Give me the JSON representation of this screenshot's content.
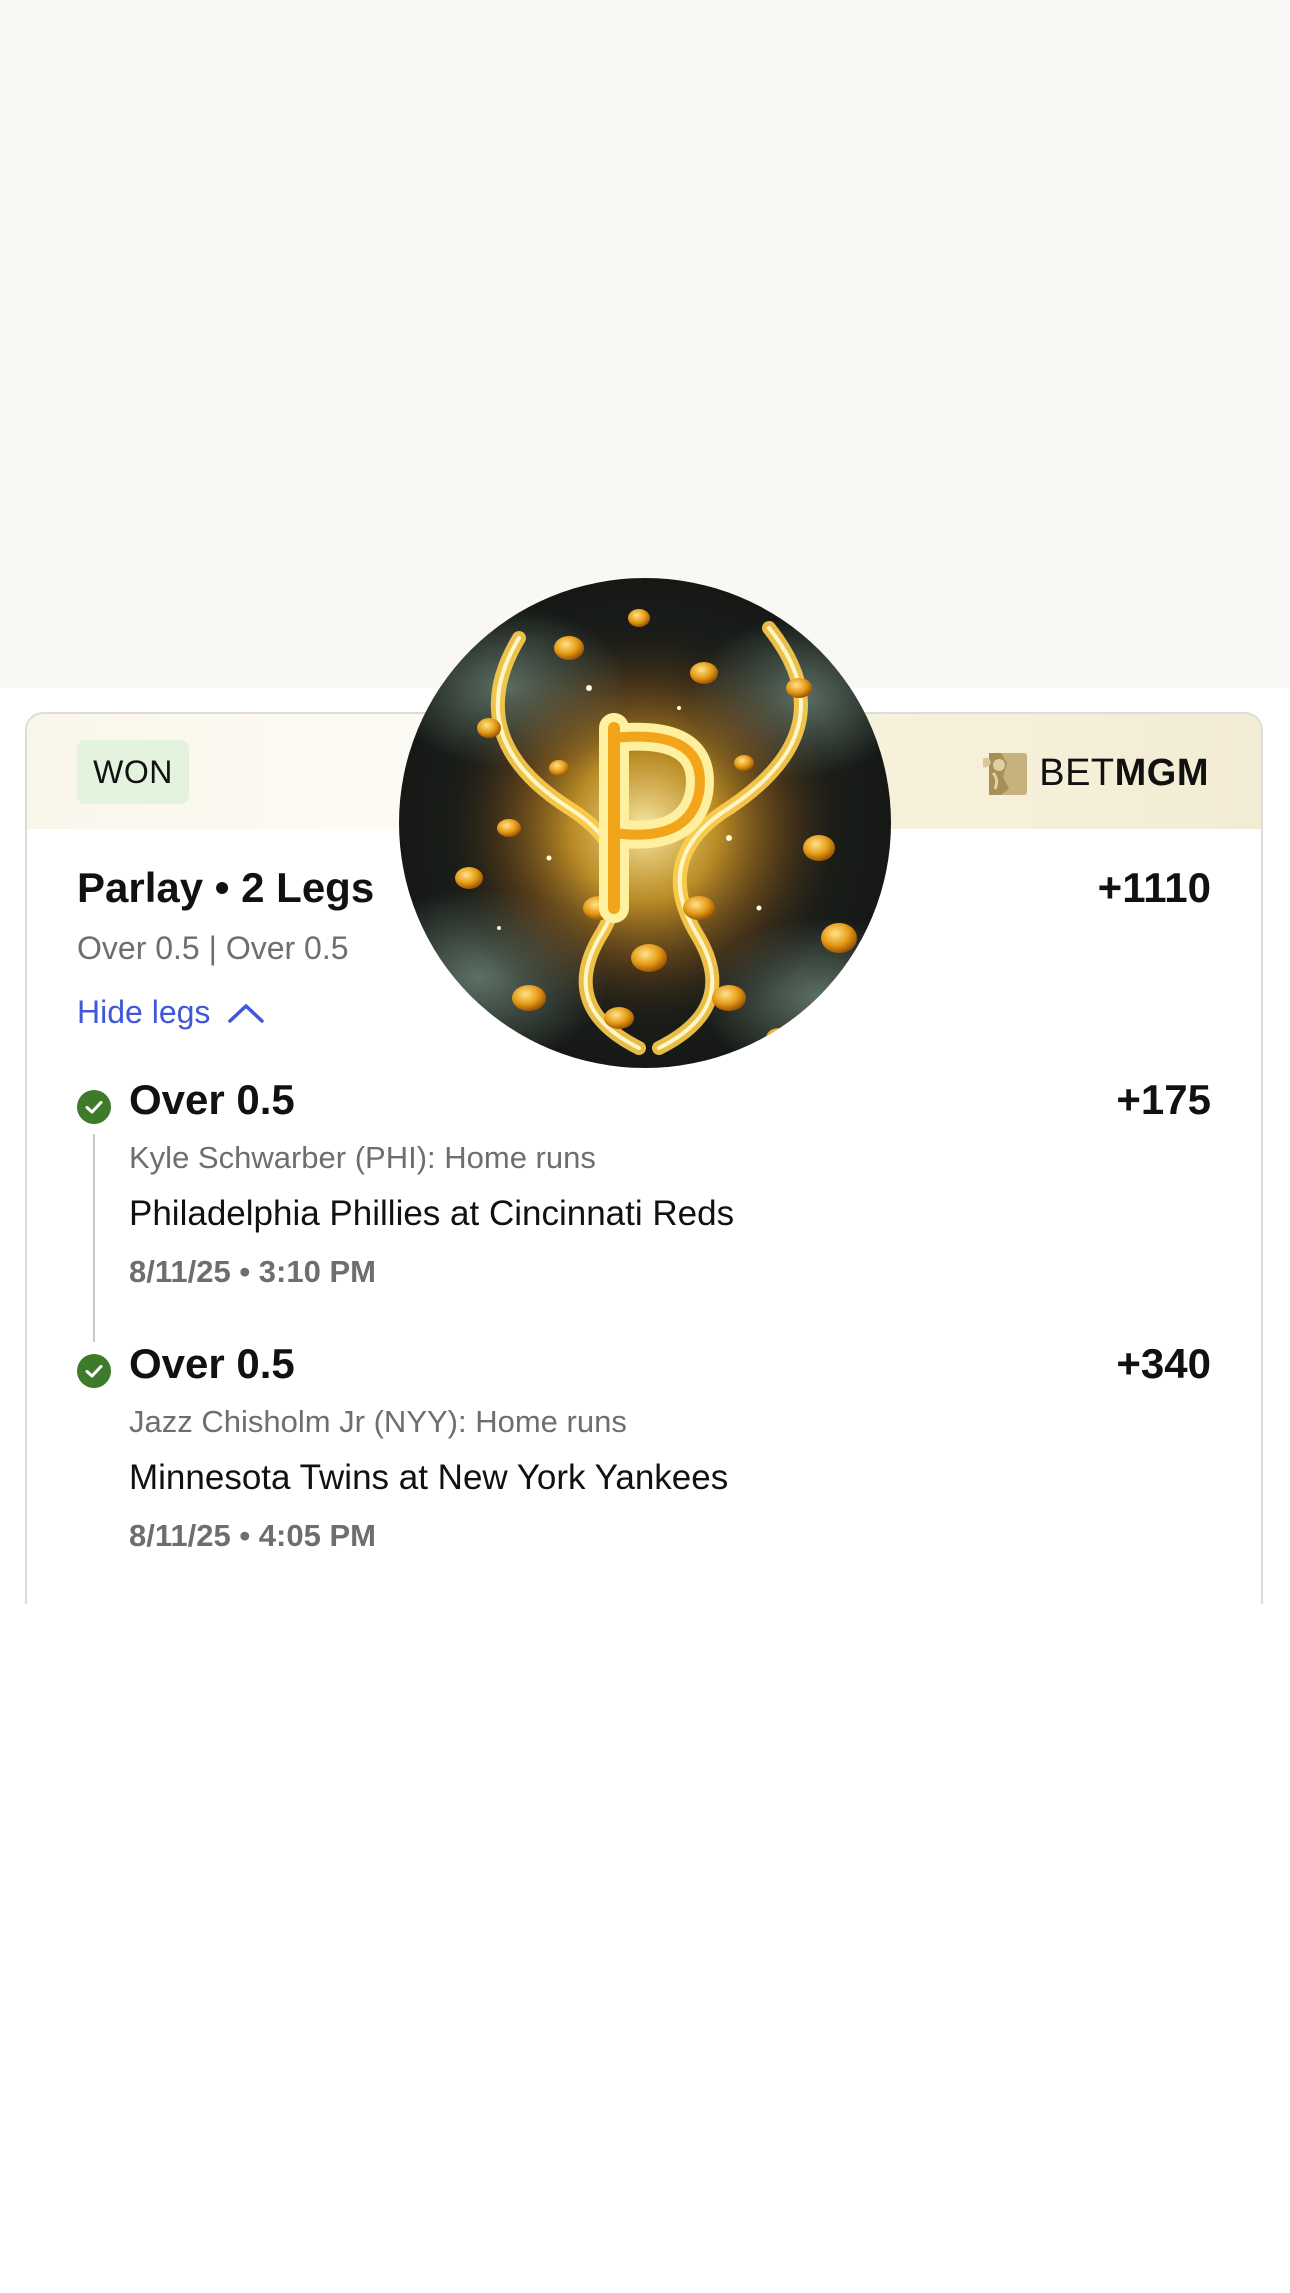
{
  "bet": {
    "status": "WON",
    "brand_prefix": "BET",
    "brand_suffix": "MGM",
    "title": "Parlay • 2 Legs",
    "odds": "+1110",
    "summary": "Over 0.5 | Over 0.5",
    "hide_legs_label": "Hide legs"
  },
  "legs": [
    {
      "selection": "Over 0.5",
      "odds": "+175",
      "market": "Kyle Schwarber (PHI): Home runs",
      "event": "Philadelphia Phillies at Cincinnati Reds",
      "datetime": "8/11/25 • 3:10 PM",
      "result": "won"
    },
    {
      "selection": "Over 0.5",
      "odds": "+340",
      "market": "Jazz Chisholm Jr (NYY): Home runs",
      "event": "Minnesota Twins at New York Yankees",
      "datetime": "8/11/25 • 4:05 PM",
      "result": "won"
    }
  ],
  "promo": {
    "letter": "P"
  },
  "colors": {
    "won_badge_bg": "#e3f3de",
    "check_green": "#3d7a2a",
    "link_blue": "#3f57d8",
    "brand_gold": "#b8a06a"
  }
}
